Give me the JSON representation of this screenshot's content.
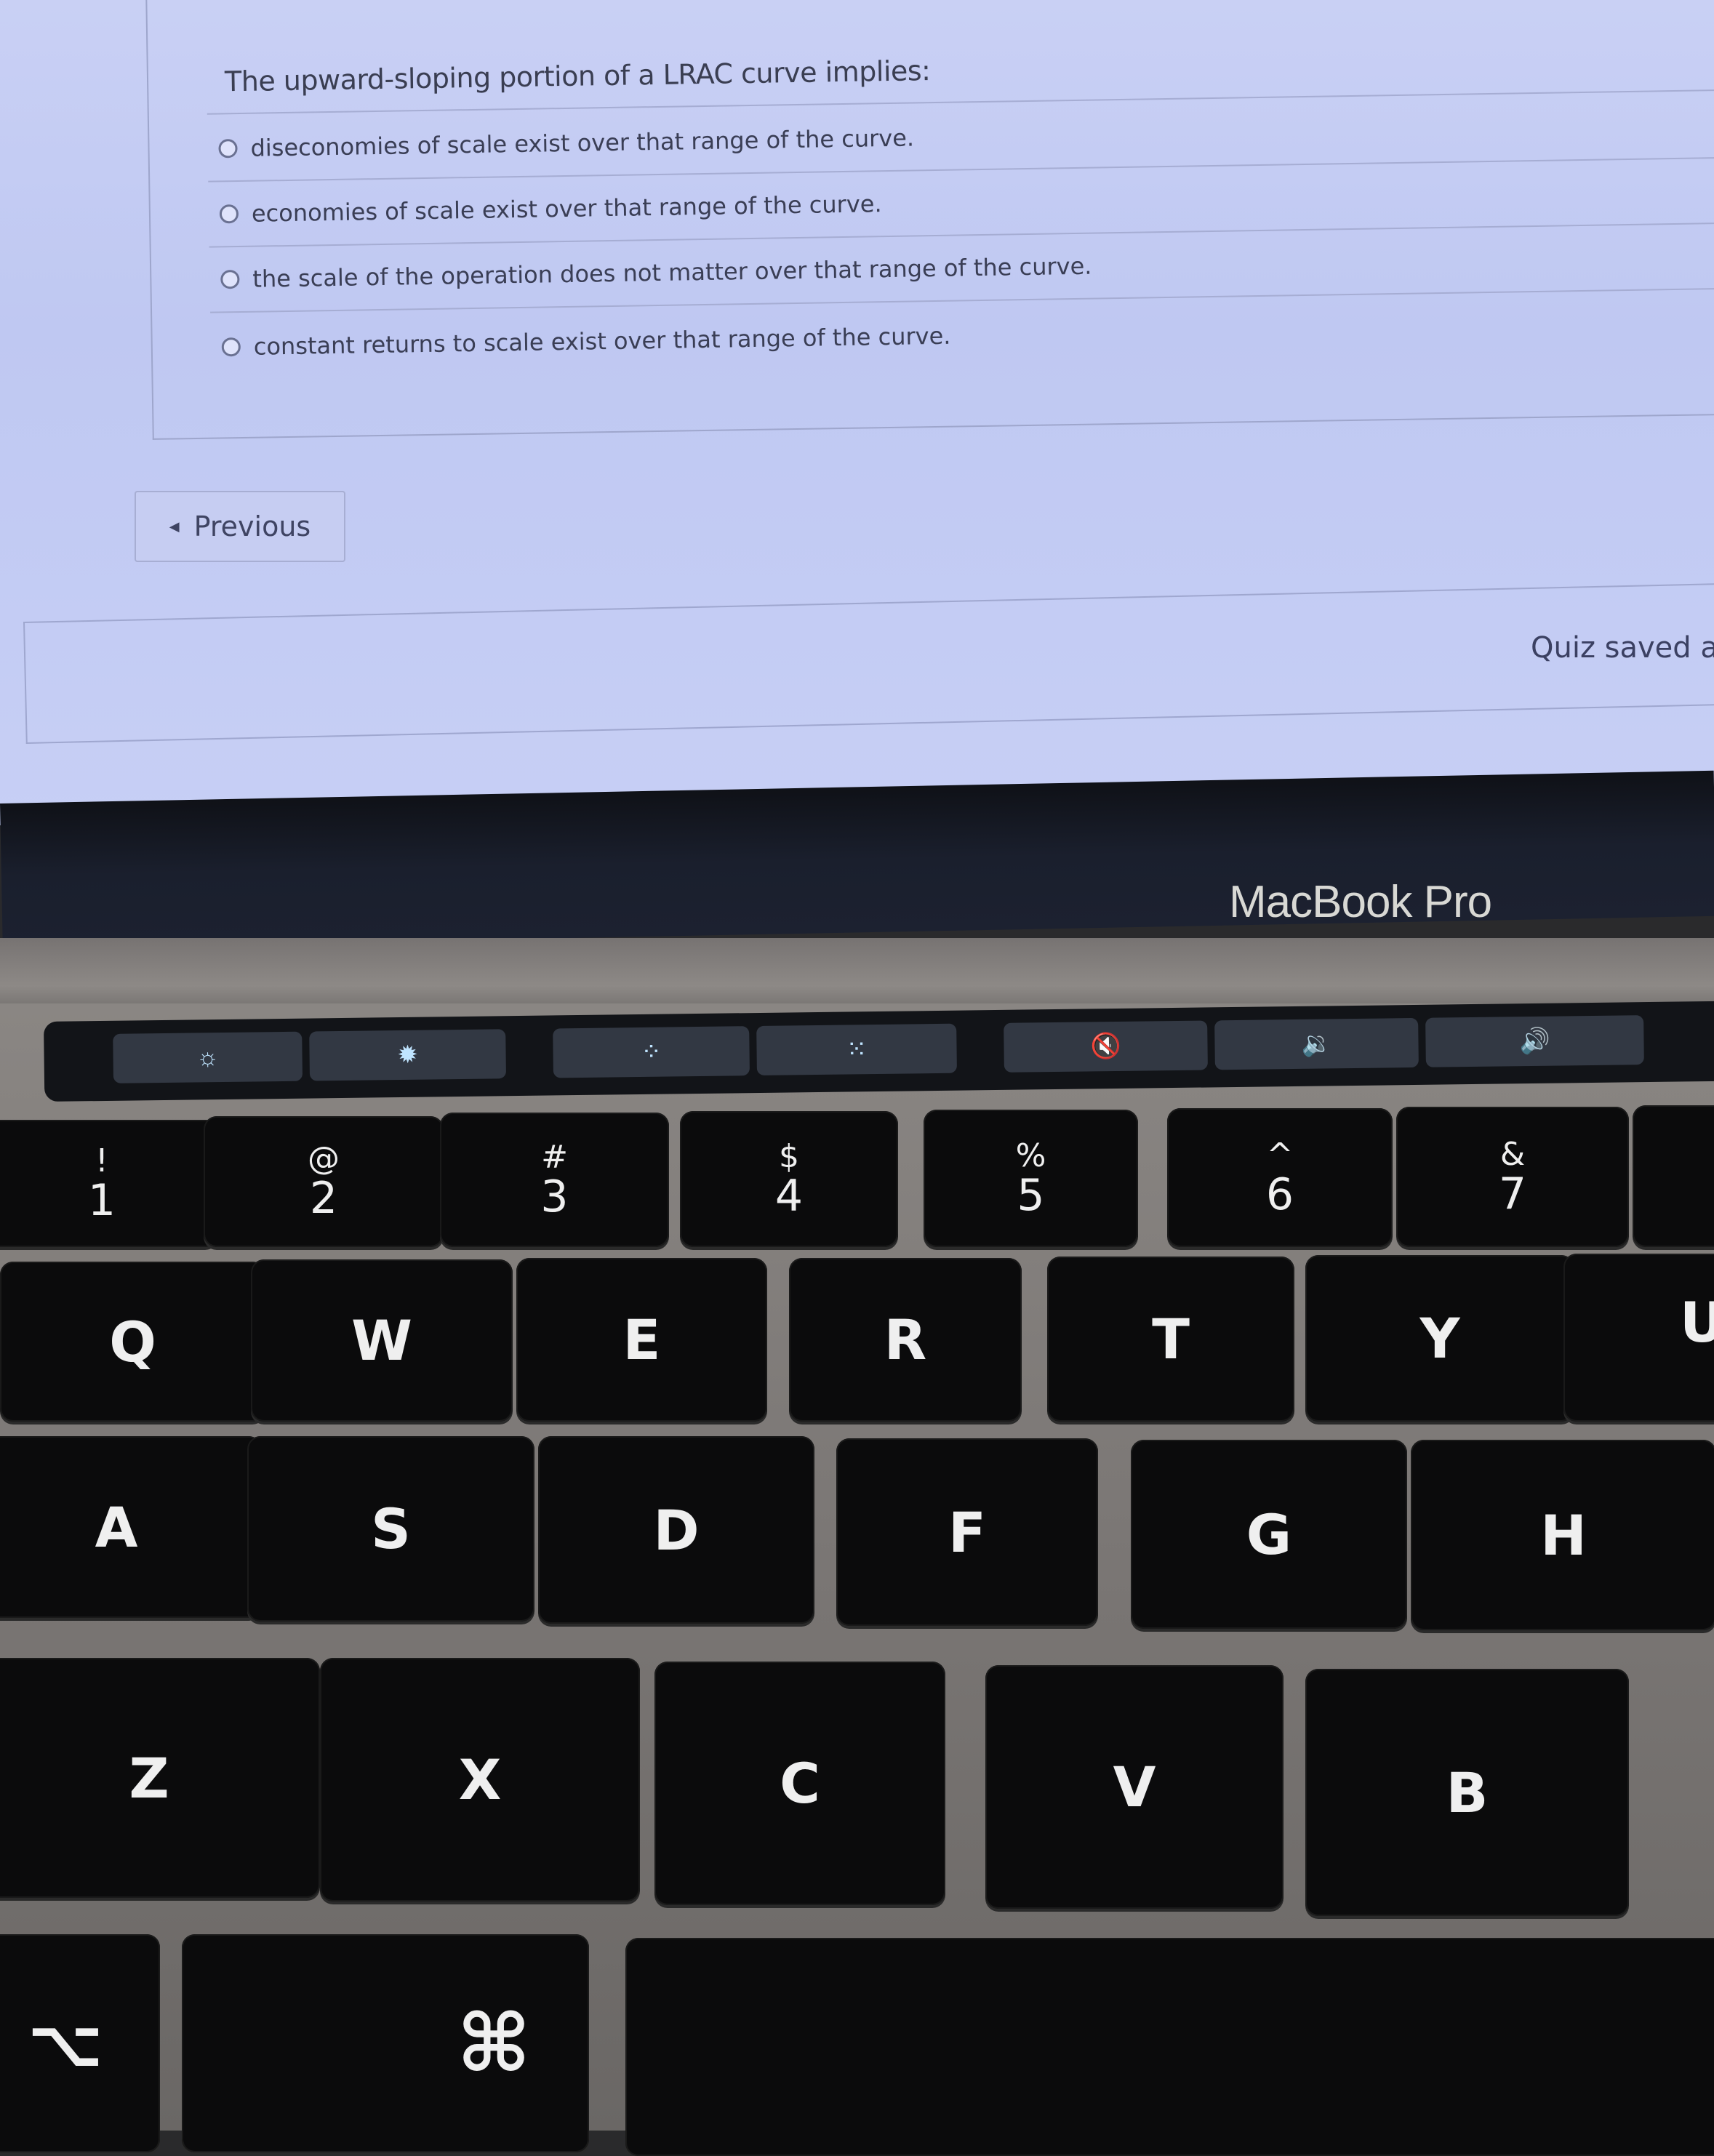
{
  "quiz": {
    "question": "The upward-sloping portion of a LRAC curve implies:",
    "options": [
      {
        "label": "diseconomies of scale exist over that range of the curve.",
        "selected": false
      },
      {
        "label": "economies of scale exist over that range of the curve.",
        "selected": false
      },
      {
        "label": "the scale of the operation does not matter over that range of the curve.",
        "selected": false
      },
      {
        "label": "constant returns to scale exist over that range of the curve.",
        "selected": false
      }
    ],
    "previous_label": "Previous",
    "saved_status": "Quiz saved a"
  },
  "laptop": {
    "brand": "MacBook Pro",
    "touchbar": [
      {
        "icon": "brightness-down-icon",
        "glyph": "☼"
      },
      {
        "icon": "brightness-up-icon",
        "glyph": "✹"
      },
      {
        "icon": "keyboard-backlight-down-icon",
        "glyph": "⁘"
      },
      {
        "icon": "keyboard-backlight-up-icon",
        "glyph": "⁙"
      },
      {
        "icon": "mute-icon",
        "glyph": "🔇"
      },
      {
        "icon": "volume-down-icon",
        "glyph": "🔉"
      },
      {
        "icon": "volume-up-icon",
        "glyph": "🔊"
      }
    ],
    "number_row": [
      {
        "sym": "!",
        "num": "1"
      },
      {
        "sym": "@",
        "num": "2"
      },
      {
        "sym": "#",
        "num": "3"
      },
      {
        "sym": "$",
        "num": "4"
      },
      {
        "sym": "%",
        "num": "5"
      },
      {
        "sym": "^",
        "num": "6"
      },
      {
        "sym": "&",
        "num": "7"
      }
    ],
    "top_row": [
      "Q",
      "W",
      "E",
      "R",
      "T",
      "Y",
      "U"
    ],
    "home_row": [
      "A",
      "S",
      "D",
      "F",
      "G",
      "H"
    ],
    "bottom_row": [
      "Z",
      "X",
      "C",
      "V",
      "B"
    ],
    "modifiers": {
      "option": "⌥",
      "command": "⌘"
    }
  }
}
